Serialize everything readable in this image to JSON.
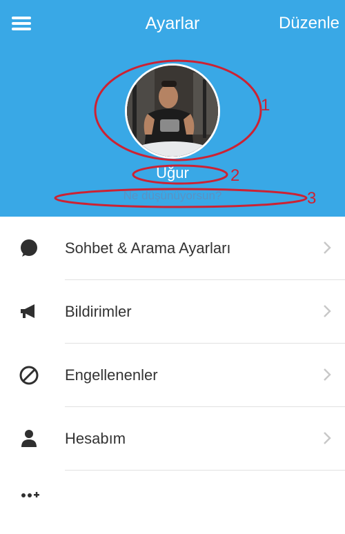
{
  "header": {
    "title": "Ayarlar",
    "edit_label": "Düzenle",
    "username": "Uğur",
    "status_placeholder": "Ne düşünüyorsun?",
    "background": "#39a8e6"
  },
  "annotations": [
    "1",
    "2",
    "3"
  ],
  "settings": {
    "items": [
      {
        "label": "Sohbet & Arama Ayarları",
        "icon": "chat-bubble-icon"
      },
      {
        "label": "Bildirimler",
        "icon": "megaphone-icon"
      },
      {
        "label": "Engellenenler",
        "icon": "blocked-icon"
      },
      {
        "label": "Hesabım",
        "icon": "person-icon"
      }
    ]
  }
}
